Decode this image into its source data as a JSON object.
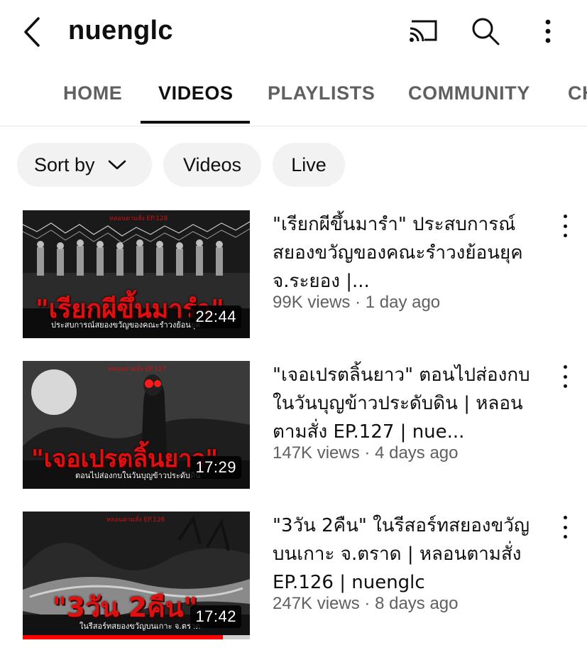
{
  "header": {
    "channel_name": "nuenglc"
  },
  "tabs": [
    {
      "label": "HOME"
    },
    {
      "label": "VIDEOS"
    },
    {
      "label": "PLAYLISTS"
    },
    {
      "label": "COMMUNITY"
    },
    {
      "label": "CH"
    }
  ],
  "active_tab": "VIDEOS",
  "chips": {
    "sort_label": "Sort by",
    "videos_label": "Videos",
    "live_label": "Live"
  },
  "videos": [
    {
      "title": "\"เรียกผีขึ้นมารำ\" ประสบการณ์สยองขวัญของคณะรำวงย้อนยุค จ.ระยอง |...",
      "views": "99K views",
      "age": "1 day ago",
      "duration": "22:44",
      "thumb_title": "\"เรียกผีขึ้นมารำ\"",
      "thumb_subtitle": "ประสบการณ์สยองขวัญของคณะรำวงย้อนยุค",
      "thumb_ep": "หลอนตามสั่ง EP.128"
    },
    {
      "title": "\"เจอเปรตลิ้นยาว\" ตอนไปส่องกบในวันบุญข้าวประดับดิน | หลอนตามสั่ง EP.127 | nue...",
      "views": "147K views",
      "age": "4 days ago",
      "duration": "17:29",
      "thumb_title": "\"เจอเปรตลิ้นยาว\"",
      "thumb_subtitle": "ตอนไปส่องกบในวันบุญข้าวประดับดิน",
      "thumb_ep": "หลอนตามสั่ง EP.127"
    },
    {
      "title": "\"3วัน 2คืน\" ในรีสอร์ทสยองขวัญบนเกาะ จ.ตราด | หลอนตามสั่ง EP.126 | nuenglc",
      "views": "247K views",
      "age": "8 days ago",
      "duration": "17:42",
      "thumb_title": "\"3วัน 2คืน\"",
      "thumb_subtitle": "ในรีสอร์ทสยองขวัญบนเกาะ จ.ตราด",
      "thumb_ep": "หลอนตามสั่ง EP.126",
      "watched_fraction": 0.88
    }
  ],
  "meta_separator": "·",
  "colors": {
    "progress": "#ff0000",
    "thumb_text": "#e01010",
    "chip_bg": "#f2f2f2",
    "meta": "#606060"
  }
}
